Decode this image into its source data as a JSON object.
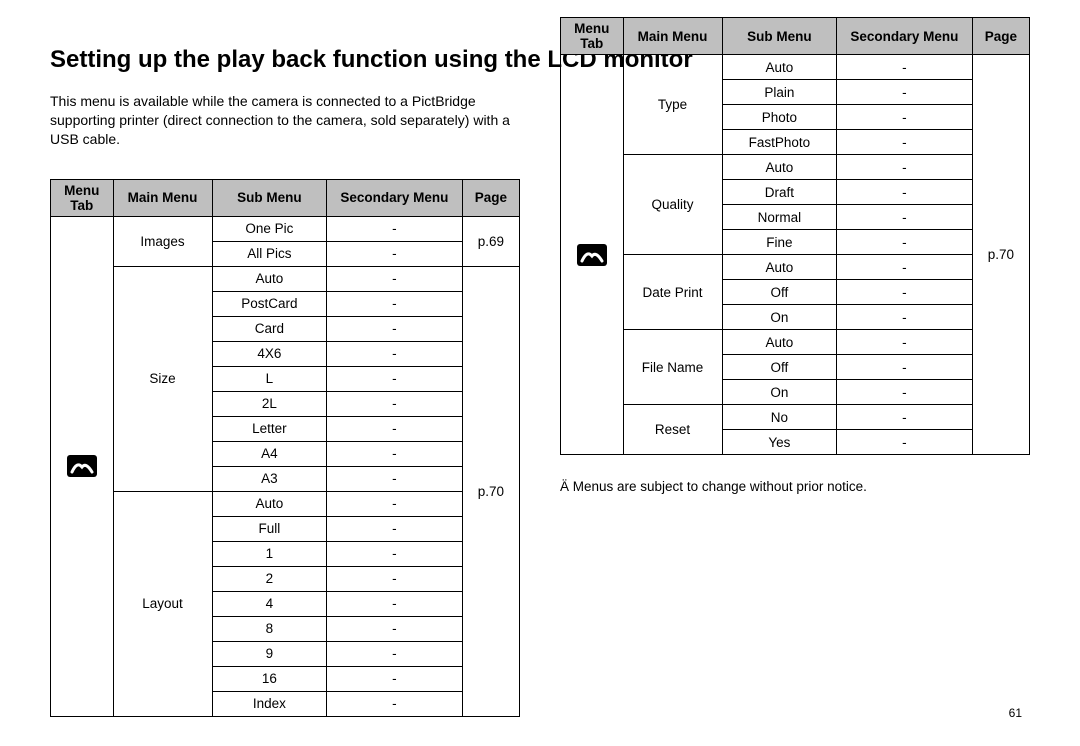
{
  "title": "Setting up the play back function using the LCD monitor",
  "intro": "This menu is available while the camera is connected to a PictBridge supporting printer (direct connection to the camera, sold separately) with a USB cable.",
  "headers": {
    "menu_tab": "Menu Tab",
    "main_menu": "Main Menu",
    "sub_menu": "Sub Menu",
    "secondary_menu": "Secondary Menu",
    "page": "Page"
  },
  "table1": {
    "images_main": "Images",
    "images": {
      "one_pic": "One Pic",
      "all_pics": "All Pics",
      "page": "p.69"
    },
    "size_main": "Size",
    "size": {
      "auto": "Auto",
      "postcard": "PostCard",
      "card": "Card",
      "fourx6": "4X6",
      "l": "L",
      "twol": "2L",
      "letter": "Letter",
      "a4": "A4",
      "a3": "A3"
    },
    "layout_main": "Layout",
    "layout": {
      "auto": "Auto",
      "full": "Full",
      "one": "1",
      "two": "2",
      "four": "4",
      "eight": "8",
      "nine": "9",
      "sixteen": "16",
      "index": "Index"
    },
    "rest_page": "p.70",
    "dash": "-"
  },
  "table2": {
    "type_main": "Type",
    "type": {
      "auto": "Auto",
      "plain": "Plain",
      "photo": "Photo",
      "fastphoto": "FastPhoto"
    },
    "quality_main": "Quality",
    "quality": {
      "auto": "Auto",
      "draft": "Draft",
      "normal": "Normal",
      "fine": "Fine"
    },
    "dateprint_main": "Date Print",
    "dateprint": {
      "auto": "Auto",
      "off": "Off",
      "on": "On"
    },
    "filename_main": "File Name",
    "filename": {
      "auto": "Auto",
      "off": "Off",
      "on": "On"
    },
    "reset_main": "Reset",
    "reset": {
      "no": "No",
      "yes": "Yes"
    },
    "page": "p.70",
    "dash": "-"
  },
  "footnote": "Ä  Menus are subject to change without prior notice.",
  "page_number": "61"
}
